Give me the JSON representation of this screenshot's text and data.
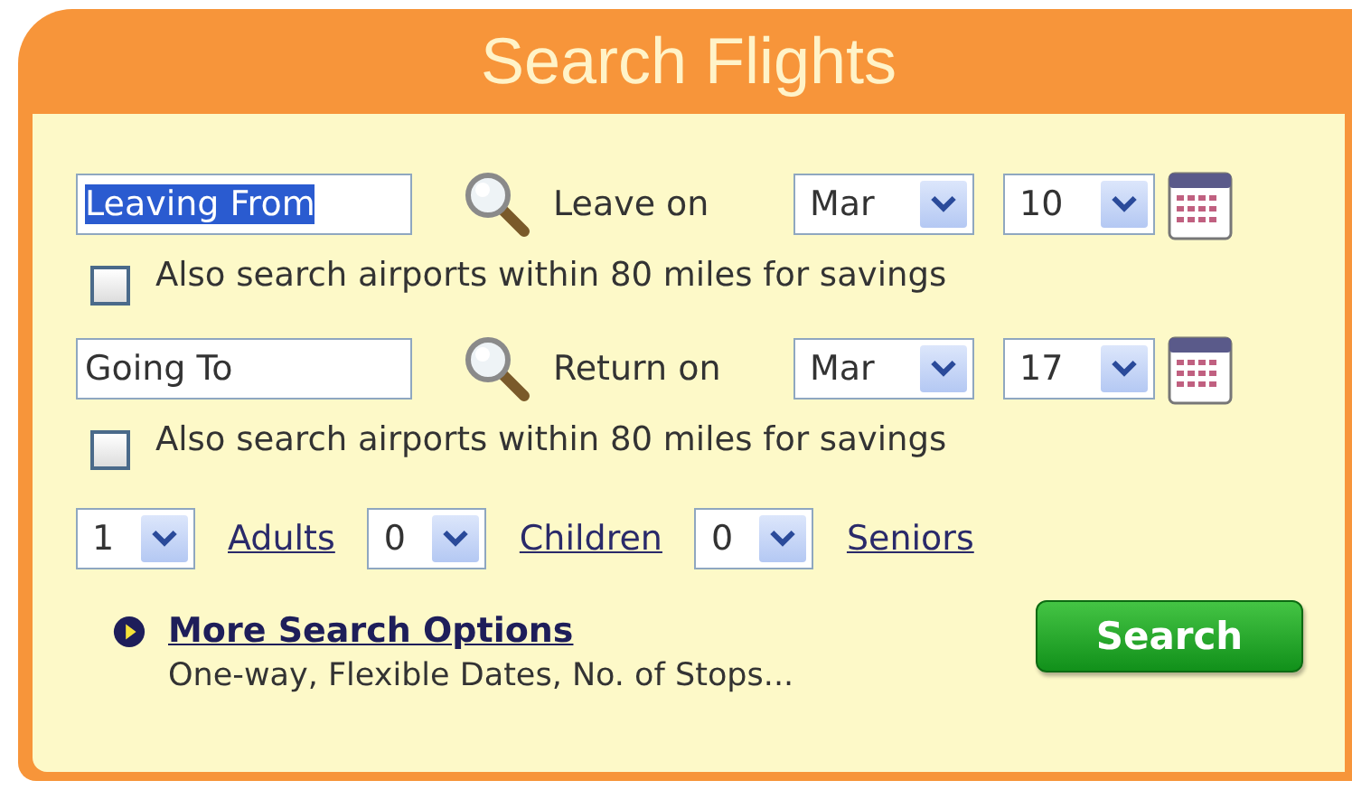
{
  "title": "Search Flights",
  "legs": [
    {
      "field": {
        "value": "Leaving From",
        "text_selected": true
      },
      "date_label": "Leave on",
      "month": "Mar",
      "day": "10",
      "nearby": {
        "label": "Also search airports within 80 miles for savings",
        "checked": false
      }
    },
    {
      "field": {
        "value": "Going To",
        "text_selected": false
      },
      "date_label": "Return on",
      "month": "Mar",
      "day": "17",
      "nearby": {
        "label": "Also search airports within 80 miles for savings",
        "checked": false
      }
    }
  ],
  "passengers": [
    {
      "count": "1",
      "label": "Adults"
    },
    {
      "count": "0",
      "label": "Children"
    },
    {
      "count": "0",
      "label": "Seniors"
    }
  ],
  "more_options": {
    "link": "More Search Options",
    "description": "One-way, Flexible Dates, No. of Stops..."
  },
  "search_button": "Search"
}
